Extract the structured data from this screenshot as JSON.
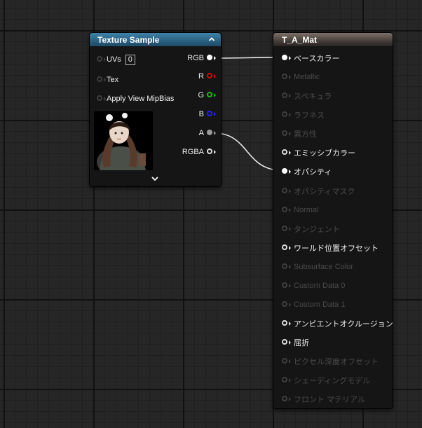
{
  "texture_sample": {
    "title": "Texture Sample",
    "inputs": [
      {
        "label": "UVs",
        "value": "0"
      },
      {
        "label": "Tex"
      },
      {
        "label": "Apply View MipBias"
      }
    ],
    "outputs": [
      {
        "label": "RGB",
        "color": "#ffffff"
      },
      {
        "label": "R",
        "color": "#e00000"
      },
      {
        "label": "G",
        "color": "#10c010"
      },
      {
        "label": "B",
        "color": "#2020ff"
      },
      {
        "label": "A",
        "color": "#9a9a9a"
      },
      {
        "label": "RGBA",
        "color": "#dddddd"
      }
    ],
    "icons": {
      "collapse": "chevron-up-icon",
      "expand": "chevron-down-icon"
    }
  },
  "material": {
    "title": "T_A_Mat",
    "inputs": [
      {
        "label": "ベースカラー",
        "state": "connected"
      },
      {
        "label": "Metallic",
        "state": "disabled"
      },
      {
        "label": "スペキュラ",
        "state": "disabled"
      },
      {
        "label": "ラフネス",
        "state": "disabled"
      },
      {
        "label": "異方性",
        "state": "disabled"
      },
      {
        "label": "エミッシブカラー",
        "state": "enabled"
      },
      {
        "label": "オパシティ",
        "state": "connected"
      },
      {
        "label": "オパシティマスク",
        "state": "disabled"
      },
      {
        "label": "Normal",
        "state": "disabled"
      },
      {
        "label": "タンジェント",
        "state": "disabled"
      },
      {
        "label": "ワールド位置オフセット",
        "state": "enabled"
      },
      {
        "label": "Subsurface Color",
        "state": "disabled"
      },
      {
        "label": "Custom Data 0",
        "state": "disabled"
      },
      {
        "label": "Custom Data 1",
        "state": "disabled"
      },
      {
        "label": "アンビエントオクルージョン",
        "state": "enabled"
      },
      {
        "label": "屈折",
        "state": "enabled"
      },
      {
        "label": "ピクセル深度オフセット",
        "state": "disabled"
      },
      {
        "label": "シェーディングモデル",
        "state": "disabled"
      },
      {
        "label": "フロント マテリアル",
        "state": "disabled"
      }
    ]
  },
  "connections": [
    {
      "from": "RGB",
      "to": "ベースカラー"
    },
    {
      "from": "A",
      "to": "オパシティ"
    }
  ],
  "colors": {
    "graph_background": "#262626",
    "texture_header": "#2f6f95",
    "material_header": "#6e625b",
    "wire": "#ffffff"
  }
}
